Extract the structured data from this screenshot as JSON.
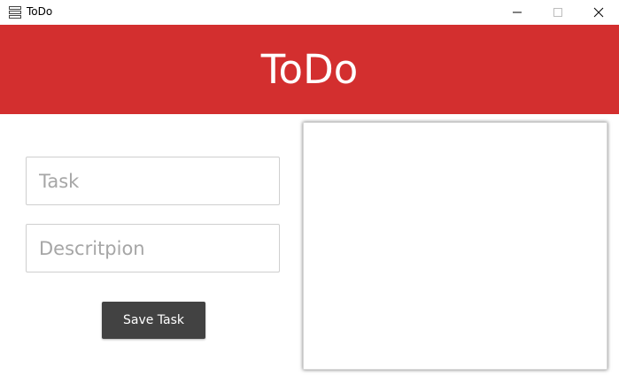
{
  "window": {
    "title": "ToDo",
    "icon": "app-list-icon",
    "controls": [
      "minimize-icon",
      "maximize-icon",
      "close-icon"
    ]
  },
  "colors": {
    "accent": "#d32f2f",
    "button": "#424242"
  },
  "header": {
    "title": "ToDo"
  },
  "form": {
    "task_placeholder": "Task",
    "task_value": "",
    "description_placeholder": "Descritpion",
    "description_value": "",
    "save_label": "Save Task"
  },
  "task_list": {
    "items": []
  }
}
